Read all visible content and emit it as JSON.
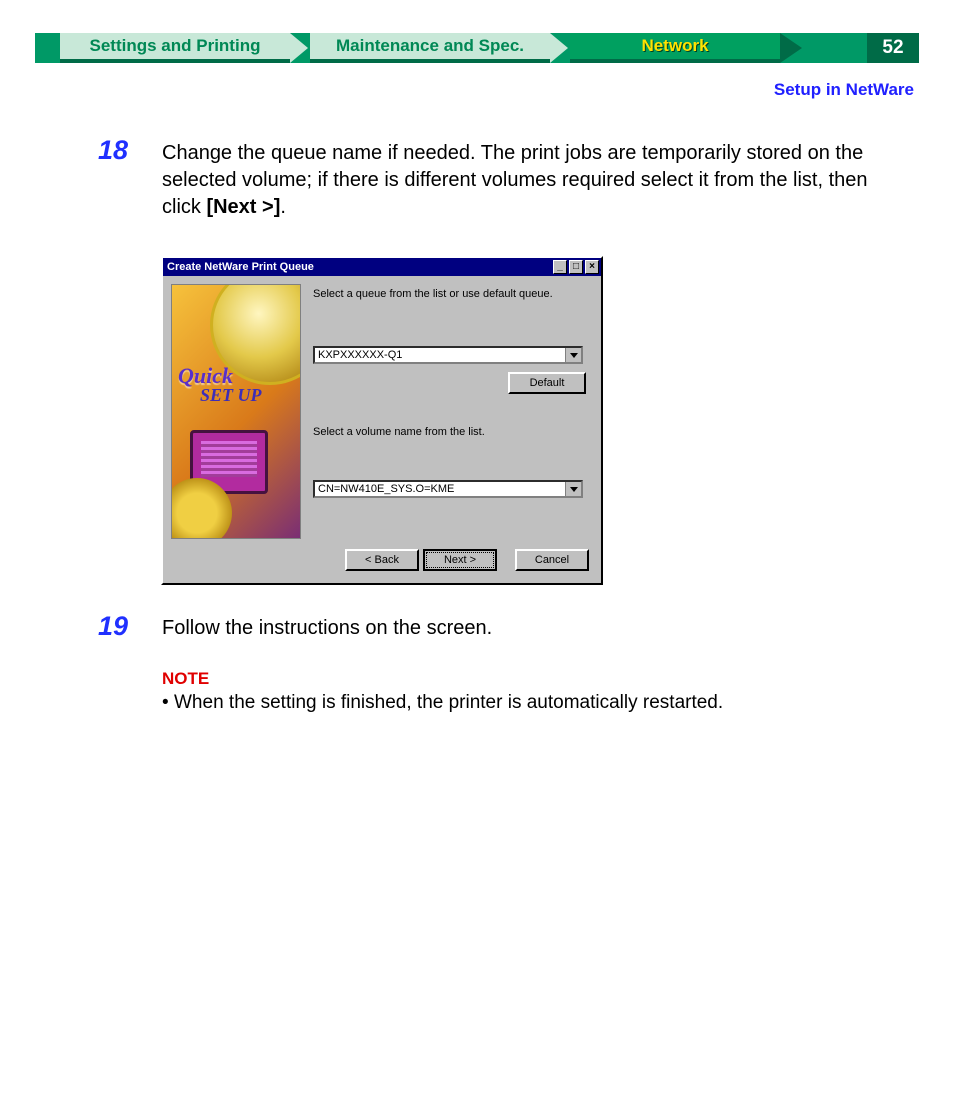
{
  "header": {
    "tabs": [
      "Settings and Printing",
      "Maintenance and Spec.",
      "Network"
    ],
    "page_number": "52",
    "breadcrumb": "Setup in NetWare"
  },
  "steps": {
    "s18": {
      "num": "18",
      "text_pre": "Change the queue name if needed. The print jobs are temporarily stored on the selected volume; if there is different volumes required select it from the list, then click ",
      "text_bold": "[Next >]",
      "text_post": "."
    },
    "s19": {
      "num": "19",
      "text": "Follow the instructions on the screen."
    }
  },
  "note": {
    "label": "NOTE",
    "text": "When the setting is finished, the printer is automatically restarted."
  },
  "dialog": {
    "title": "Create NetWare Print Queue",
    "label_queue": "Select a queue from the list or use default queue.",
    "queue_value": "KXPXXXXXX-Q1",
    "btn_default": "Default",
    "label_volume": "Select a volume name from the list.",
    "volume_value": "CN=NW410E_SYS.O=KME",
    "btn_back": "< Back",
    "btn_next": "Next >",
    "btn_cancel": "Cancel",
    "sidebar": {
      "line1": "Quick",
      "line2": "SET UP"
    }
  }
}
